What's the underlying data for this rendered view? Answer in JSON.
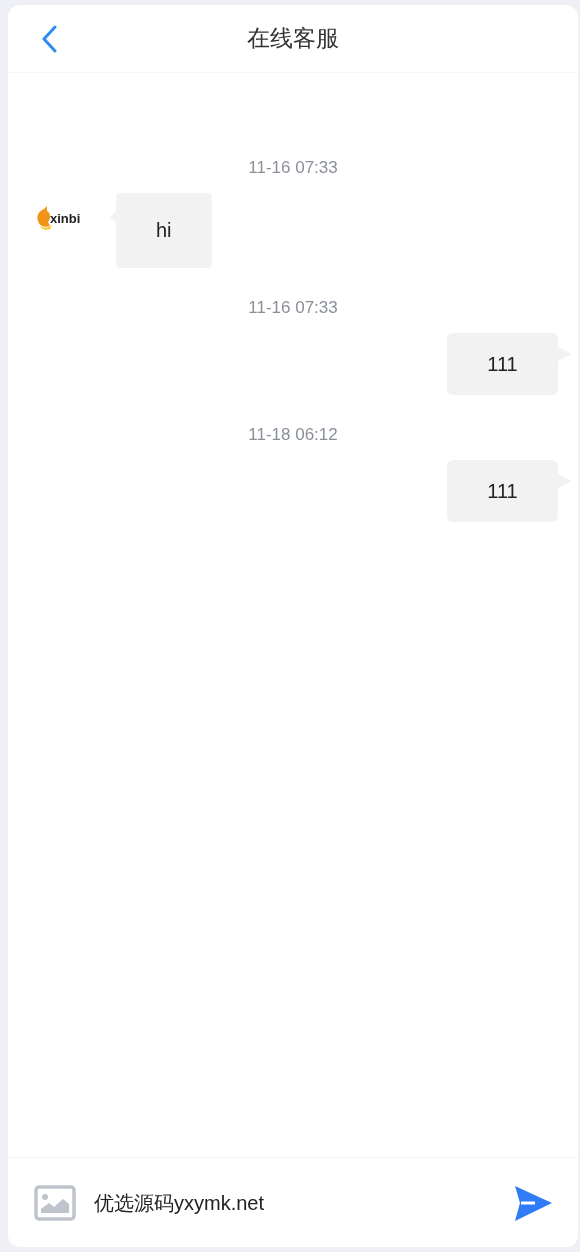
{
  "header": {
    "title": "在线客服"
  },
  "messages": [
    {
      "kind": "received",
      "time": "11-16 07:33",
      "text": "hi",
      "avatar": {
        "logo_text": "xinbi"
      }
    },
    {
      "kind": "sent",
      "time": "11-16 07:33",
      "text": "111"
    },
    {
      "kind": "sent",
      "time": "11-18 06:12",
      "text": "111"
    }
  ],
  "composer": {
    "value": "优选源码yxymk.net"
  }
}
